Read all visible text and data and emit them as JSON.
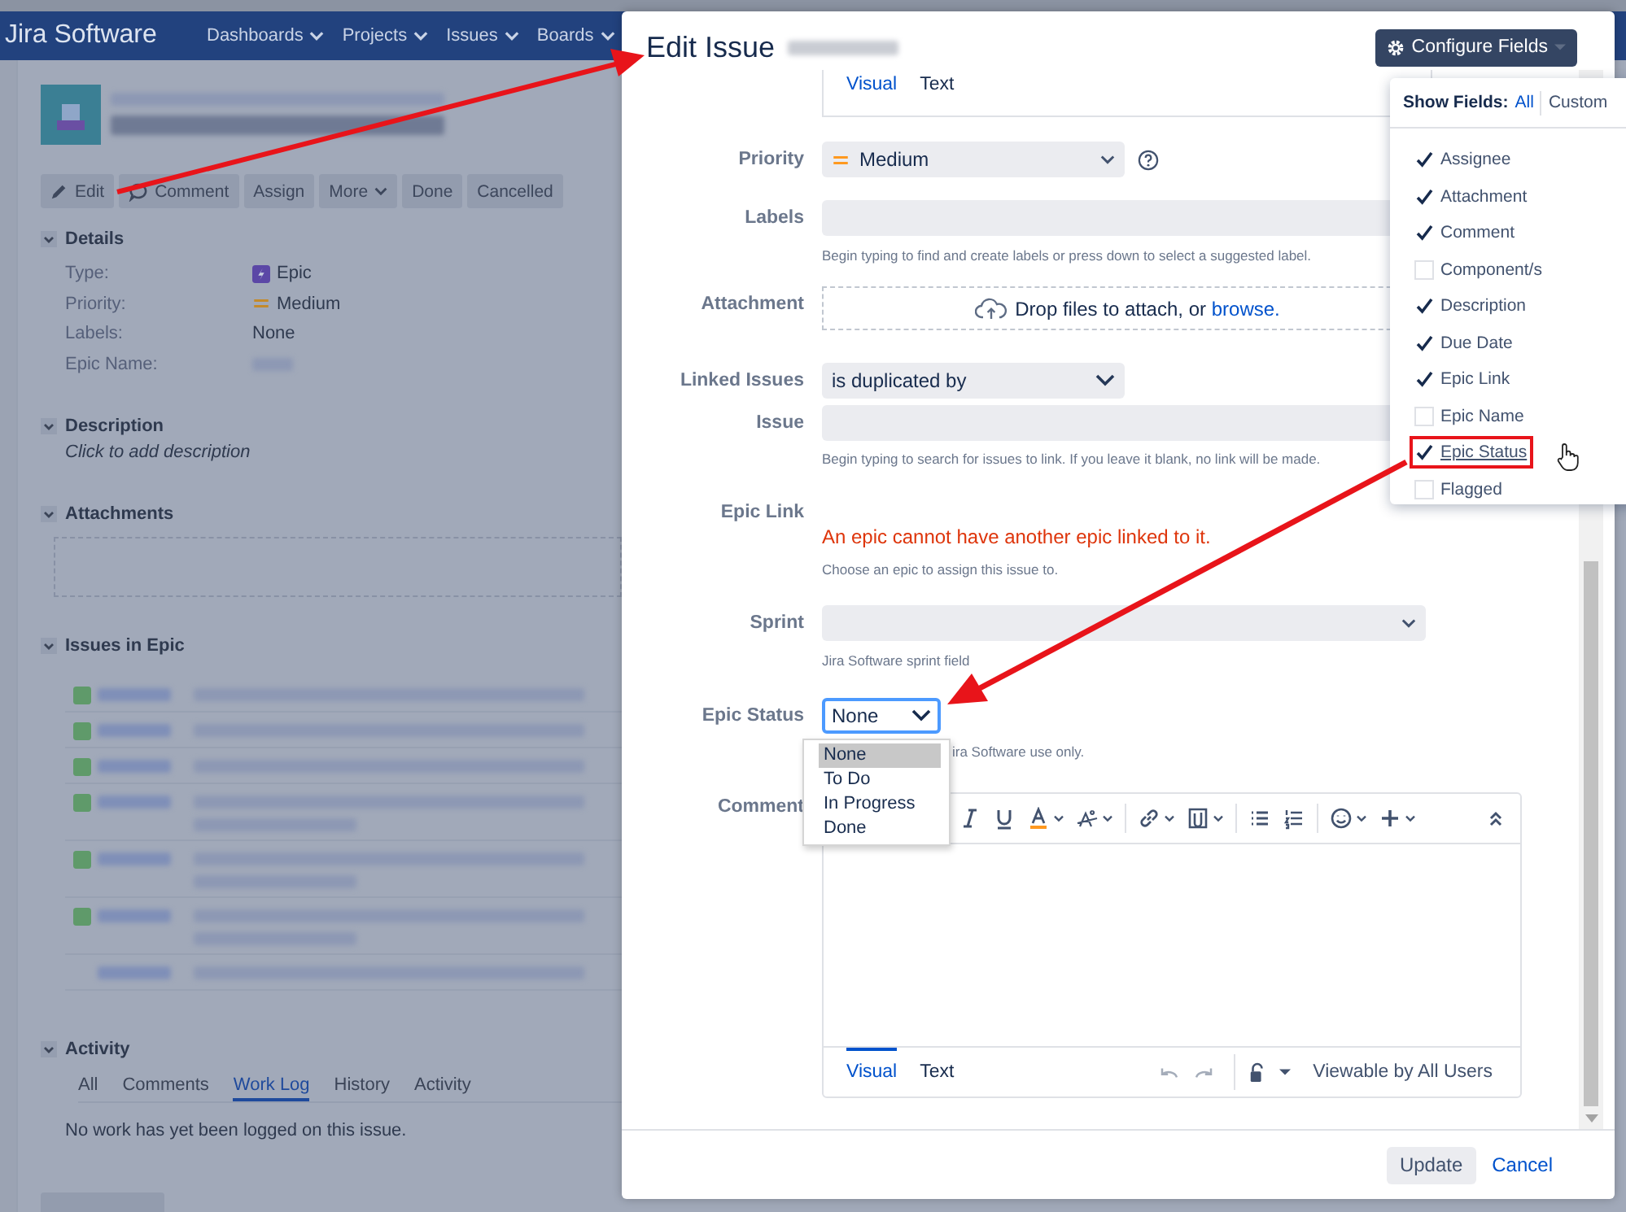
{
  "nav": {
    "logo": "Jira Software",
    "menus": [
      "Dashboards",
      "Projects",
      "Issues",
      "Boards"
    ]
  },
  "issue_actions": [
    {
      "label": "Edit",
      "kind": "edit"
    },
    {
      "label": "Comment",
      "kind": "comment"
    },
    {
      "label": "Assign",
      "kind": "plain"
    },
    {
      "label": "More",
      "kind": "dropdown"
    },
    {
      "label": "Done",
      "kind": "plain"
    },
    {
      "label": "Cancelled",
      "kind": "plain"
    }
  ],
  "details": {
    "title": "Details",
    "expanded": true,
    "rows": [
      {
        "label": "Type:",
        "value": "Epic",
        "kind": "type"
      },
      {
        "label": "Priority:",
        "value": "Medium",
        "kind": "priority"
      },
      {
        "label": "Labels:",
        "value": "None",
        "kind": "plain"
      },
      {
        "label": "Epic Name:",
        "kind": "hidden"
      }
    ]
  },
  "description": {
    "title": "Description",
    "expanded": true,
    "text": "Click to add description"
  },
  "attachments": {
    "title": "Attachments",
    "expanded": true
  },
  "issues_in_epic": {
    "title": "Issues in Epic",
    "expanded": true,
    "issues": [
      {
        "kind": "story"
      },
      {
        "kind": "story"
      },
      {
        "kind": "story"
      },
      {
        "kind": "story_long"
      },
      {
        "kind": "story_long"
      },
      {
        "kind": "story_long"
      },
      {
        "kind": "plain"
      }
    ]
  },
  "activity": {
    "title": "Activity",
    "expanded": true,
    "tabs": [
      {
        "label": "All",
        "selected": false
      },
      {
        "label": "Comments",
        "selected": false
      },
      {
        "label": "Work Log",
        "selected": true
      },
      {
        "label": "History",
        "selected": false
      },
      {
        "label": "Activity",
        "selected": false
      }
    ],
    "message": "No work has yet been logged on this issue."
  },
  "dialog": {
    "title": "Edit Issue",
    "configure_button": "Configure Fields",
    "fields": [
      {
        "kind": "editor_tail",
        "tabs": [
          {
            "label": "Visual",
            "selected": true
          },
          {
            "label": "Text",
            "selected": false
          }
        ]
      },
      {
        "kind": "priority_select",
        "label": "Priority",
        "value": "Medium"
      },
      {
        "kind": "text",
        "label": "Labels",
        "hint": "Begin typing to find and create labels or press down to select a suggested label."
      },
      {
        "kind": "dropzone",
        "label": "Attachment",
        "text": "Drop files to attach, or",
        "link": "browse."
      },
      {
        "kind": "linked",
        "label": "Linked Issues",
        "value": "is duplicated by",
        "sub_label": "Issue",
        "hint": "Begin typing to search for issues to link. If you leave it blank, no link will be made."
      },
      {
        "kind": "message",
        "label": "Epic Link",
        "error": "An epic cannot have another epic linked to it.",
        "hint": "Choose an epic to assign this issue to."
      },
      {
        "kind": "select_wide",
        "label": "Sprint",
        "hint": "Jira Software sprint field"
      },
      {
        "kind": "select_open",
        "label": "Epic Status",
        "value": "None",
        "hint": "ira Software use only.",
        "options": [
          {
            "label": "None",
            "selected": true
          },
          {
            "label": "To Do",
            "selected": false
          },
          {
            "label": "In Progress",
            "selected": false
          },
          {
            "label": "Done",
            "selected": false
          }
        ]
      },
      {
        "kind": "editor",
        "label": "Comment",
        "tabs": [
          {
            "label": "Visual",
            "selected": true
          },
          {
            "label": "Text",
            "selected": false
          }
        ],
        "visibility": "Viewable by All Users"
      }
    ],
    "update_button": "Update",
    "cancel_link": "Cancel"
  },
  "configure_menu": {
    "label": "Show Fields:",
    "modes": [
      {
        "label": "All",
        "selected": true
      },
      {
        "label": "Custom",
        "selected": false
      }
    ],
    "items": [
      {
        "label": "Assignee",
        "checked": true,
        "highlighted": false
      },
      {
        "label": "Attachment",
        "checked": true,
        "highlighted": false
      },
      {
        "label": "Comment",
        "checked": true,
        "highlighted": false
      },
      {
        "label": "Component/s",
        "checked": false,
        "highlighted": false
      },
      {
        "label": "Description",
        "checked": true,
        "highlighted": false
      },
      {
        "label": "Due Date",
        "checked": true,
        "highlighted": false
      },
      {
        "label": "Epic Link",
        "checked": true,
        "highlighted": false
      },
      {
        "label": "Epic Name",
        "checked": false,
        "highlighted": false
      },
      {
        "label": "Epic Status",
        "checked": true,
        "highlighted": true
      },
      {
        "label": "Flagged",
        "checked": false,
        "highlighted": false
      }
    ]
  }
}
